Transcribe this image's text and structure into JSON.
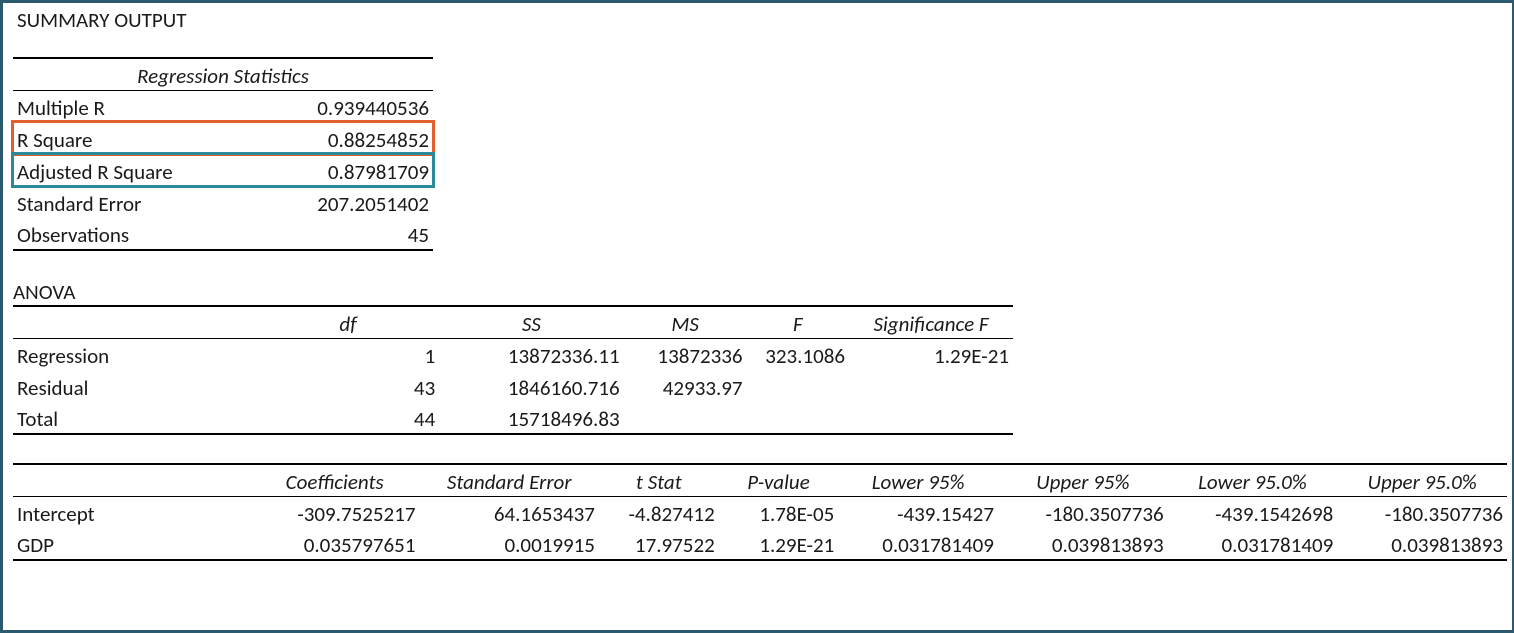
{
  "title": "SUMMARY OUTPUT",
  "regStats": {
    "header": "Regression Statistics",
    "rows": [
      {
        "label": "Multiple R",
        "value": "0.939440536"
      },
      {
        "label": "R Square",
        "value": "0.88254852"
      },
      {
        "label": "Adjusted R Square",
        "value": "0.87981709"
      },
      {
        "label": "Standard Error",
        "value": "207.2051402"
      },
      {
        "label": "Observations",
        "value": "45"
      }
    ]
  },
  "anova": {
    "title": "ANOVA",
    "headers": {
      "df": "df",
      "ss": "SS",
      "ms": "MS",
      "f": "F",
      "sigf": "Significance F"
    },
    "rows": [
      {
        "label": "Regression",
        "df": "1",
        "ss": "13872336.11",
        "ms": "13872336",
        "f": "323.1086",
        "sigf": "1.29E-21"
      },
      {
        "label": "Residual",
        "df": "43",
        "ss": "1846160.716",
        "ms": "42933.97",
        "f": "",
        "sigf": ""
      },
      {
        "label": "Total",
        "df": "44",
        "ss": "15718496.83",
        "ms": "",
        "f": "",
        "sigf": ""
      }
    ]
  },
  "coef": {
    "headers": {
      "coef": "Coefficients",
      "se": "Standard Error",
      "t": "t Stat",
      "p": "P-value",
      "l95": "Lower 95%",
      "u95": "Upper 95%",
      "l95b": "Lower 95.0%",
      "u95b": "Upper 95.0%"
    },
    "rows": [
      {
        "label": "Intercept",
        "coef": "-309.7525217",
        "se": "64.1653437",
        "t": "-4.827412",
        "p": "1.78E-05",
        "l95": "-439.15427",
        "u95": "-180.3507736",
        "l95b": "-439.1542698",
        "u95b": "-180.3507736"
      },
      {
        "label": "GDP",
        "coef": "0.035797651",
        "se": "0.0019915",
        "t": "17.97522",
        "p": "1.29E-21",
        "l95": "0.031781409",
        "u95": "0.039813893",
        "l95b": "0.031781409",
        "u95b": "0.039813893"
      }
    ]
  },
  "highlights": {
    "rSquareColor": "#e0602e",
    "adjRSquareColor": "#2a8a9c"
  }
}
